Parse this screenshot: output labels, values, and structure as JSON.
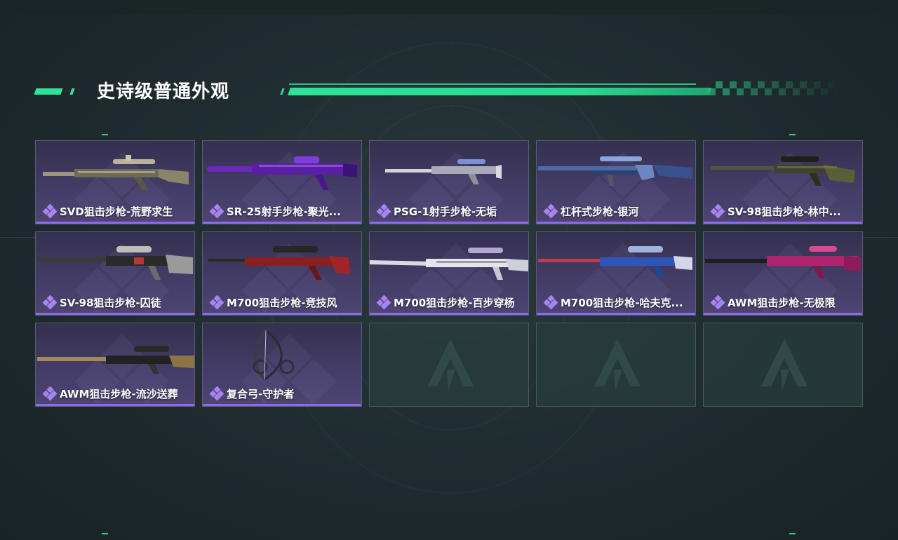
{
  "section": {
    "title": "史诗级普通外观"
  },
  "items": [
    {
      "name": "SVD狙击步枪-荒野求生",
      "icon": "camo-sniper-rifle"
    },
    {
      "name": "SR-25射手步枪-聚光...",
      "icon": "purple-marksman-rifle"
    },
    {
      "name": "PSG-1射手步枪-无垢",
      "icon": "white-marksman-rifle"
    },
    {
      "name": "杠杆式步枪-银河",
      "icon": "galaxy-lever-rifle"
    },
    {
      "name": "SV-98狙击步枪-林中...",
      "icon": "forest-sniper-rifle"
    },
    {
      "name": "SV-98狙击步枪-囚徒",
      "icon": "prisoner-sniper-rifle"
    },
    {
      "name": "M700狙击步枪-竞技风",
      "icon": "red-sniper-rifle"
    },
    {
      "name": "M700狙击步枪-百步穿杨",
      "icon": "white-sniper-rifle"
    },
    {
      "name": "M700狙击步枪-哈夫克...",
      "icon": "blue-sniper-rifle"
    },
    {
      "name": "AWM狙击步枪-无极限",
      "icon": "pink-sniper-rifle"
    },
    {
      "name": "AWM狙击步枪-流沙送葬",
      "icon": "sand-sniper-rifle"
    },
    {
      "name": "复合弓-守护者",
      "icon": "compound-bow"
    }
  ],
  "empty_slot_icon": "game-logo-icon",
  "colors": {
    "accent_green": "#2fe29a",
    "rarity_purple": "#8d6ae6",
    "card_bg": "#433c66",
    "empty_bg": "#283e3c"
  }
}
